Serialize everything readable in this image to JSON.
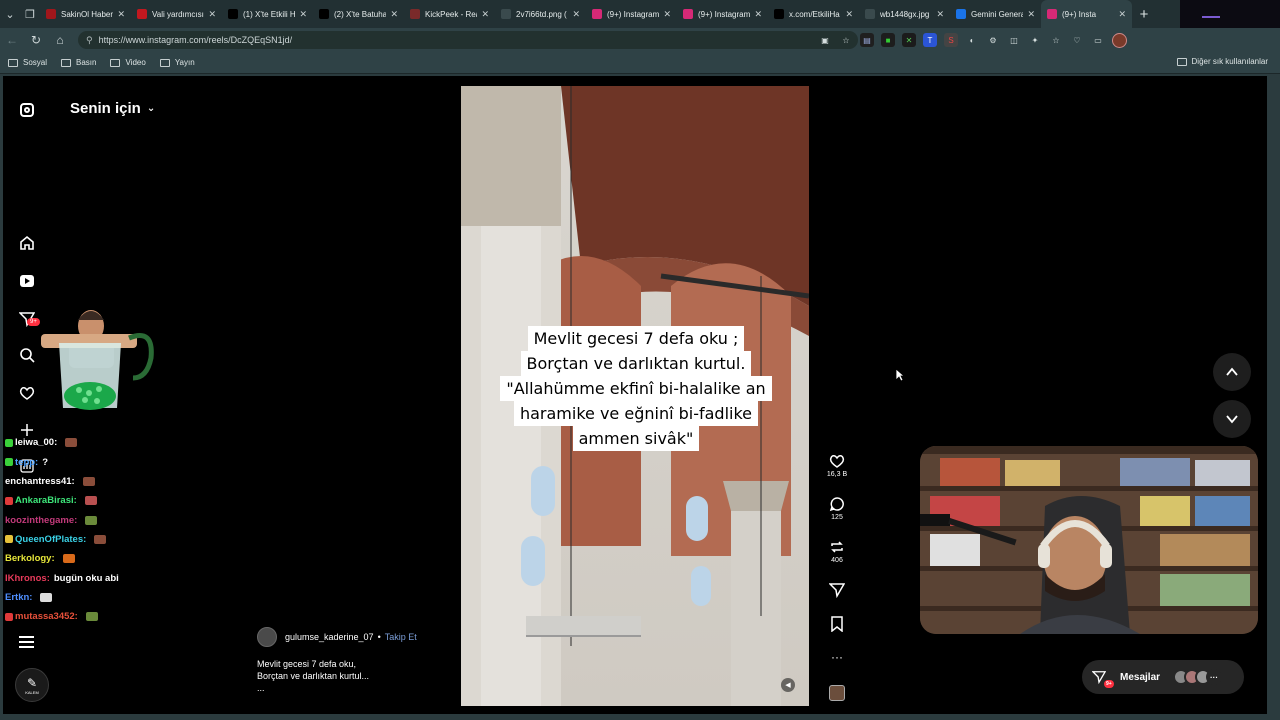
{
  "browser": {
    "tabs": [
      {
        "label": "SakinOl Haber",
        "favicon_color": "#a0161b",
        "icon": "news-icon"
      },
      {
        "label": "Vali yardımcısı",
        "favicon_color": "#c2181f",
        "icon": "youtube-icon"
      },
      {
        "label": "(1) X'te Etkili H",
        "favicon_color": "#000000",
        "icon": "x-icon"
      },
      {
        "label": "(2) X'te Batuha",
        "favicon_color": "#000000",
        "icon": "x-icon"
      },
      {
        "label": "KickPeek - Rea",
        "favicon_color": "#7a2a2a",
        "icon": "kickpeek-icon"
      },
      {
        "label": "2v7i66td.png (",
        "favicon_color": "#3a4a4d",
        "icon": "globe-icon"
      },
      {
        "label": "(9+) Instagram",
        "favicon_color": "#d62976",
        "icon": "instagram-icon"
      },
      {
        "label": "(9+) Instagram",
        "favicon_color": "#d62976",
        "icon": "instagram-icon"
      },
      {
        "label": "x.com/EtkiliHa",
        "favicon_color": "#000000",
        "icon": "x-icon"
      },
      {
        "label": "wb1448gx.jpg",
        "favicon_color": "#3a4a4d",
        "icon": "globe-icon"
      },
      {
        "label": "Gemini Genera",
        "favicon_color": "#1a73e8",
        "icon": "gemini-icon"
      },
      {
        "label": "(9+) Insta",
        "favicon_color": "#d62976",
        "icon": "instagram-icon",
        "active": true
      }
    ],
    "url": "https://www.instagram.com/reels/DcZQEqSN1jd/",
    "bookmarks": [
      "Sosyal",
      "Basın",
      "Video",
      "Yayın"
    ],
    "bookmarks_right": "Diğer sık kullanılanlar"
  },
  "instagram": {
    "feed_title": "Senin için",
    "notif_badge": "9+",
    "reel": {
      "caption_lines": [
        "Mevlit gecesi 7 defa oku ;",
        "Borçtan ve darlıktan kurtul.",
        "\"Allahümme ekfinî bi-halalike an",
        "haramike ve eğninî bi-fadlike",
        "ammen sivâk\""
      ],
      "author": "gulumse_kaderine_07",
      "follow_label": "Takip Et",
      "description_lines": [
        "Mevlit gecesi 7 defa oku,",
        "Borçtan ve darlıktan kurtul...",
        "..."
      ],
      "likes": "16,3 B",
      "comments": "125",
      "reposts": "406"
    },
    "messages_label": "Mesajlar",
    "messages_badge": "9+"
  },
  "chat": [
    {
      "user": "",
      "msg": "",
      "color": "#ff4f4f"
    },
    {
      "user": "leiwa_00:",
      "msg": "",
      "color": "#ffffff",
      "emote": "#8a4d3a",
      "pre": "#3ad13a"
    },
    {
      "user": "tepp:",
      "msg": "?",
      "color": "#4fa3ff",
      "pre": "#3ad13a"
    },
    {
      "user": "enchantress41:",
      "msg": "",
      "color": "#ffffff",
      "emote": "#8a4d3a"
    },
    {
      "user": "AnkaraBirasi:",
      "msg": "",
      "color": "#3ee67a",
      "emote": "#b85050",
      "pre": "#e03a3a"
    },
    {
      "user": "koozinthegame:",
      "msg": "",
      "color": "#c23a7a",
      "emote": "#6a8a3a"
    },
    {
      "user": "QueenOfPlates:",
      "msg": "",
      "color": "#3ad1e6",
      "emote": "#8a4d3a",
      "pre": "#e6c23a"
    },
    {
      "user": "Berkology:",
      "msg": "",
      "color": "#e6e63a",
      "emote": "#d96a1a"
    },
    {
      "user": "IKhronos:",
      "msg": "bugün oku abi",
      "color": "#e63a5a"
    },
    {
      "user": "Ertkn:",
      "msg": "",
      "color": "#4f8fff",
      "emote": "#dddddd"
    },
    {
      "user": "mutassa3452:",
      "msg": "",
      "color": "#e6503a",
      "emote": "#6a8a3a",
      "pre": "#e03a3a"
    }
  ],
  "kalem_label": "KALEM"
}
